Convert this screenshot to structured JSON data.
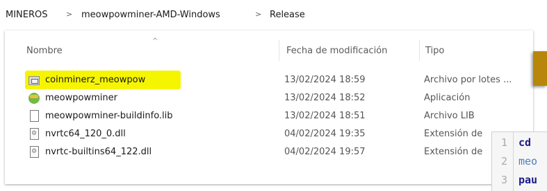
{
  "breadcrumb": {
    "items": [
      "MINEROS",
      "meowpowminer-AMD-Windows",
      "Release"
    ],
    "separator": ">"
  },
  "columns": {
    "name": "Nombre",
    "date": "Fecha de modificación",
    "type": "Tipo"
  },
  "files": [
    {
      "icon": "batch-file-icon",
      "name": "coinminerz_meowpow",
      "date": "13/02/2024 18:59",
      "type": "Archivo por lotes ...",
      "highlighted": true
    },
    {
      "icon": "application-icon",
      "name": "meowpowminer",
      "date": "13/02/2024 18:52",
      "type": "Aplicación"
    },
    {
      "icon": "file-icon",
      "name": "meowpowminer-buildinfo.lib",
      "date": "13/02/2024 18:51",
      "type": "Archivo LIB"
    },
    {
      "icon": "dll-file-icon",
      "name": "nvrtc64_120_0.dll",
      "date": "04/02/2024 19:35",
      "type": "Extensión de"
    },
    {
      "icon": "dll-file-icon",
      "name": "nvrtc-builtins64_122.dll",
      "date": "04/02/2024 19:57",
      "type": "Extensión de"
    }
  ],
  "editor": {
    "lines": [
      {
        "num": "1",
        "text": "cd"
      },
      {
        "num": "2",
        "text": "meo"
      },
      {
        "num": "3",
        "text": "pau"
      }
    ]
  },
  "colors": {
    "highlight": "#f6f500",
    "gold": "#b8860b"
  }
}
